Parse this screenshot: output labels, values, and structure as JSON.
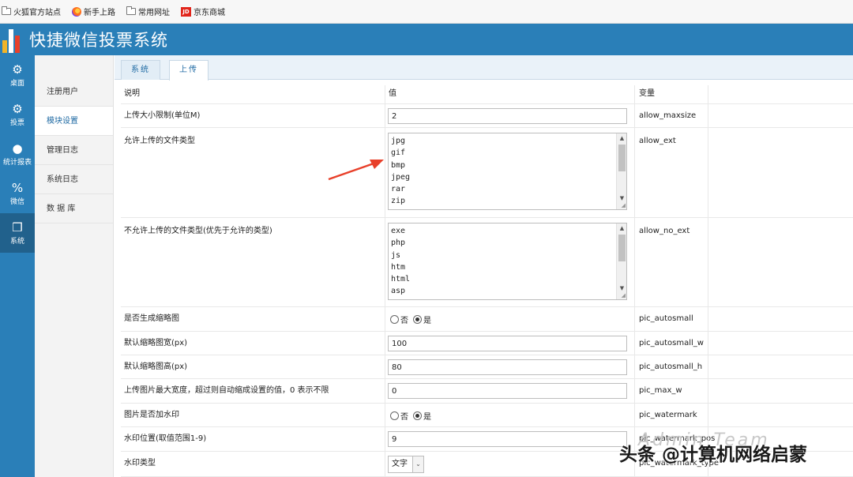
{
  "bookmarks": [
    {
      "label": "火狐官方站点",
      "icon": "folder-icon"
    },
    {
      "label": "新手上路",
      "icon": "firefox-icon"
    },
    {
      "label": "常用网址",
      "icon": "folder-icon"
    },
    {
      "label": "京东商城",
      "icon": "jd-icon"
    }
  ],
  "header": {
    "title": "快捷微信投票系统",
    "color": "#2a7fb8"
  },
  "leftnav": [
    {
      "label": "桌面",
      "icon": "gear-icon"
    },
    {
      "label": "投票",
      "icon": "gear-icon"
    },
    {
      "label": "统计报表",
      "icon": "user-icon"
    },
    {
      "label": "微信",
      "icon": "percent-icon"
    },
    {
      "label": "系统",
      "icon": "box-icon",
      "active": true
    }
  ],
  "sidebar": {
    "items": [
      {
        "label": "注册用户"
      },
      {
        "label": "模块设置",
        "active": true
      },
      {
        "label": "管理日志"
      },
      {
        "label": "系统日志"
      },
      {
        "label": "数 据 库"
      }
    ]
  },
  "tabs": [
    {
      "label": "系统"
    },
    {
      "label": "上传",
      "active": true
    }
  ],
  "table": {
    "headers": [
      "说明",
      "值",
      "变量"
    ],
    "rows": {
      "maxsize": {
        "label": "上传大小限制(单位M)",
        "value": "2",
        "var": "allow_maxsize"
      },
      "ext": {
        "label": "允许上传的文件类型",
        "lines": "jpg\ngif\nbmp\njpeg\nrar\nzip",
        "var": "allow_ext"
      },
      "noext": {
        "label": "不允许上传的文件类型(优先于允许的类型)",
        "lines": "exe\nphp\njs\nhtm\nhtml\nasp",
        "var": "allow_no_ext"
      },
      "autosmall": {
        "label": "是否生成缩略图",
        "no": "否",
        "yes": "是",
        "var": "pic_autosmall"
      },
      "autosmall_w": {
        "label": "默认缩略图宽(px)",
        "value": "100",
        "var": "pic_autosmall_w"
      },
      "autosmall_h": {
        "label": "默认缩略图高(px)",
        "value": "80",
        "var": "pic_autosmall_h"
      },
      "max_w": {
        "label": "上传图片最大宽度，超过则自动缩成设置的值，0 表示不限",
        "value": "0",
        "var": "pic_max_w"
      },
      "watermark": {
        "label": "图片是否加水印",
        "no": "否",
        "yes": "是",
        "var": "pic_watermark"
      },
      "wm_pos": {
        "label": "水印位置(取值范围1-9)",
        "value": "9",
        "var": "pic_watermark_pos"
      },
      "wm_type": {
        "label": "水印类型",
        "value": "文字",
        "var": "pic_watermark_type"
      }
    }
  },
  "watermark": {
    "brand": "Admin Team",
    "text": "头条 @计算机网络启蒙"
  },
  "annotation": {
    "color": "#e8402a"
  }
}
